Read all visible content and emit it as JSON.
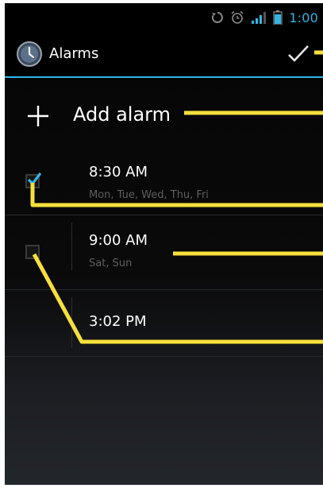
{
  "status_bar": {
    "time": "1:00",
    "icons": [
      "sync-icon",
      "alarm-clock-icon",
      "signal-icon",
      "battery-icon"
    ]
  },
  "action_bar": {
    "title": "Alarms",
    "app_icon": "clock-icon",
    "done_icon": "checkmark-icon"
  },
  "add_alarm": {
    "label": "Add alarm",
    "icon": "plus-icon"
  },
  "alarms": [
    {
      "time": "8:30 AM",
      "days": "Mon, Tue, Wed, Thu, Fri",
      "enabled": true
    },
    {
      "time": "9:00 AM",
      "days": "Sat, Sun",
      "enabled": false
    },
    {
      "time": "3:02 PM",
      "days": "",
      "enabled": false
    }
  ],
  "colors": {
    "accent": "#33b5e5",
    "annotation": "#f7e03c",
    "background": "#000000",
    "text": "#ffffff",
    "secondary_text": "#5e5e5e"
  }
}
